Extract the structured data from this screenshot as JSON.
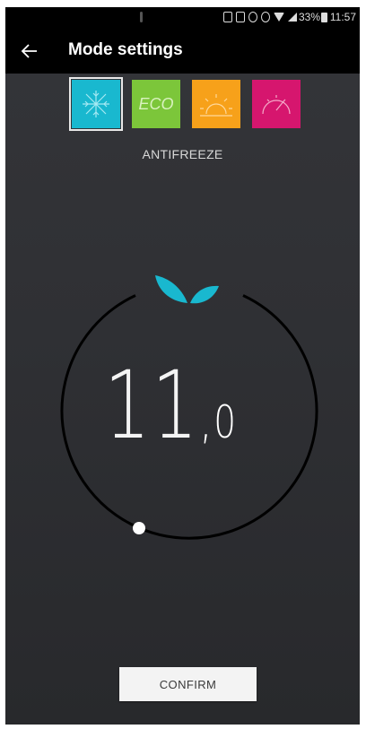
{
  "status_bar": {
    "battery_percent": "33%",
    "time": "11:57"
  },
  "app_bar": {
    "back_icon": "arrow-left-icon",
    "title": "Mode settings"
  },
  "modes": [
    {
      "name": "antifreeze",
      "icon": "snowflake-icon",
      "color": "#19b8cf",
      "selected": true
    },
    {
      "name": "eco",
      "icon_text": "ECO",
      "color": "#7cc63a",
      "selected": false
    },
    {
      "name": "comfort",
      "icon": "sun-icon",
      "color": "#f7a11a",
      "selected": false
    },
    {
      "name": "boost",
      "icon": "gauge-icon",
      "color": "#d6166e",
      "selected": false
    }
  ],
  "selected_mode_label": "ANTIFREEZE",
  "dial": {
    "eco_icon": "leaf-icon",
    "eco_icon_color": "#19b8cf",
    "temperature_integer": "11",
    "temperature_separator": ",",
    "temperature_decimal": "0"
  },
  "confirm_label": "CONFIRM"
}
